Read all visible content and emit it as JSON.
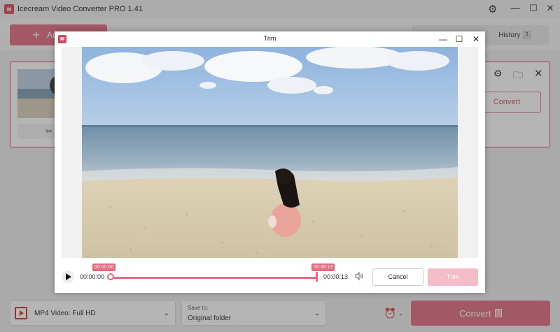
{
  "app": {
    "title": "Icecream Video Converter PRO 1.41",
    "logo_icon": "icecream-logo-icon",
    "brand_color": "#d8485f"
  },
  "window_controls": {
    "minimize": "—",
    "maximize": "☐",
    "close": "✕"
  },
  "toolbar": {
    "add_video_label": "Add video",
    "history_tab": {
      "label": "History",
      "count": "3"
    }
  },
  "file_card": {
    "convert_label": "Convert",
    "trim_icon": "scissors-icon"
  },
  "bottom_bar": {
    "format_value": "MP4 Video: Full HD",
    "save_to_caption": "Save to:",
    "save_to_value": "Original folder",
    "convert_label": "Convert",
    "convert_count": "1"
  },
  "trim_dialog": {
    "title": "Trim",
    "current_time": "00:00:00",
    "total_time": "00:00:13",
    "start_marker": "00:00:00",
    "end_marker": "00:00:13",
    "trim_range_fraction": [
      0.0,
      1.0
    ],
    "cancel_label": "Cancel",
    "trim_label": "Trim"
  }
}
